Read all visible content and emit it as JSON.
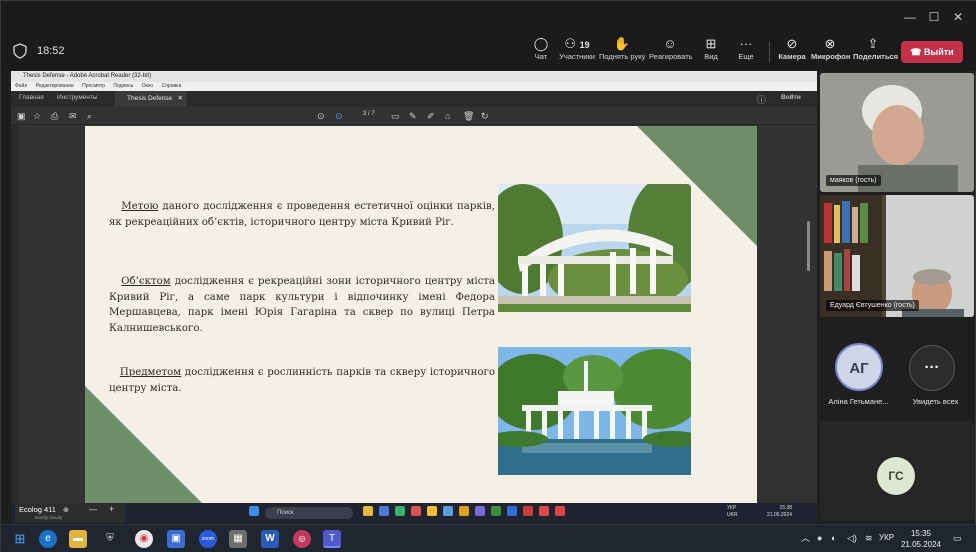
{
  "meeting": {
    "timer": "18:52",
    "toolbar": {
      "chat": "Чат",
      "participants": "Участники",
      "participants_count": "19",
      "raise_hand": "Поднять руку",
      "react": "Реагировать",
      "view": "Вид",
      "more": "Еще",
      "camera": "Камера",
      "mic": "Микрофон",
      "share": "Поделиться",
      "leave": "Выйти"
    }
  },
  "acrobat": {
    "window_title": "Thesis Defense - Adobe Acrobat Reader (32-bit)",
    "menu": [
      "Файл",
      "Редактирование",
      "Просмотр",
      "Подпись",
      "Окно",
      "Справка"
    ],
    "tabs": {
      "home": "Главная",
      "tools": "Инструменты",
      "doc": "Thesis Defense"
    },
    "signin": "Войти",
    "page_current": "3",
    "page_total": "/ 7"
  },
  "slide": {
    "p1_key": "Метою",
    "p1_text": " даного дослідження є проведення естетичної оцінки парків, як рекреаційних об’єктів, історичного центру міста Кривий Ріг.",
    "p2_key": "Об’єктом",
    "p2_text": " дослідження є рекреаційні зони історичного центру міста Кривий Ріг, а саме парк культури і відпочинку імені Федора Мершавцева, парк імені Юрія Гагаріна та сквер по вулиці Петра Калнишевського.",
    "p3_key": "Предметом",
    "p3_text": " дослідження є рослинність парків та скверу історичного центру міста."
  },
  "inner_taskbar": {
    "ecolog_name": "Ecolog 411",
    "ecolog_sub": "Mostly cloudy",
    "search": "Поиск",
    "lang_top": "УКР",
    "lang_bottom": "UKR",
    "time": "15:38",
    "date": "21.05.2024"
  },
  "participants": [
    {
      "name": "маяков (гость)"
    },
    {
      "name": "Едуард Євтушенко (гость)"
    },
    {
      "initials": "АГ",
      "name": "Аліна Гетьмане..."
    },
    {
      "label": "Увидеть всех"
    },
    {
      "initials": "ГС"
    }
  ],
  "taskbar": {
    "lang": "УКР",
    "time": "15:35",
    "date": "21.05.2024"
  },
  "colors": {
    "leave": "#c4314b",
    "slide_bg": "#f4f0e6",
    "slide_accent": "#6f8f6a",
    "avatar_ag": "#cfd6e8",
    "avatar_gs": "#dde8d2"
  }
}
